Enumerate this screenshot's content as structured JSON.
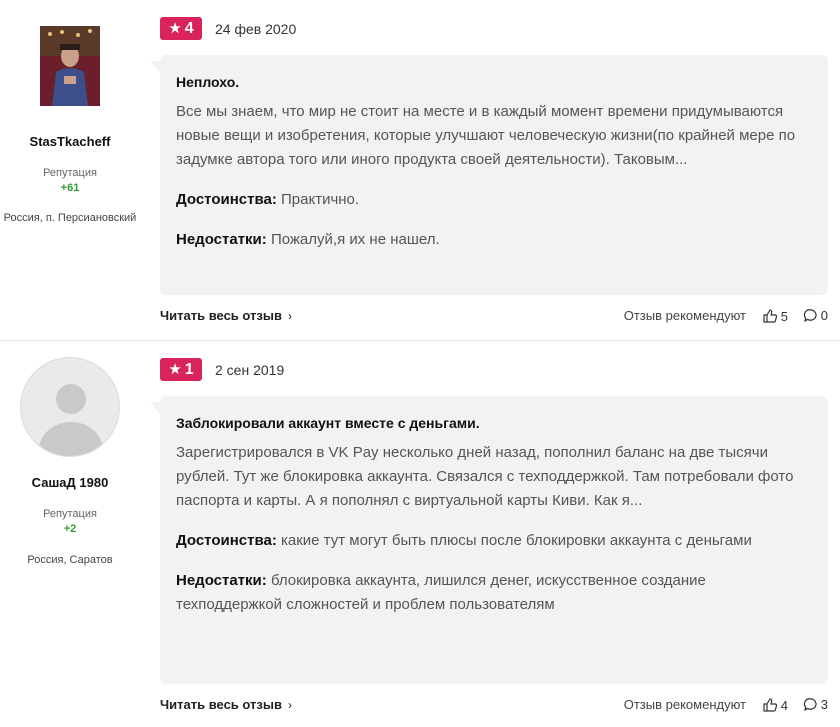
{
  "reviews": [
    {
      "author": {
        "name": "StasTkacheff",
        "reputation_label": "Репутация",
        "reputation_value": "+61",
        "location": "Россия, п. Персиановский"
      },
      "rating": "4",
      "date": "24 фев 2020",
      "title": "Неплохо.",
      "text": "Все мы знаем, что мир не стоит на месте и в каждый момент времени придумываются новые вещи и изобретения, которые улучшают человеческую жизни(по крайней мере по задумке автора того или иного продукта своей деятельности). Таковым...",
      "pros_label": "Достоинства:",
      "pros": "Практично.",
      "cons_label": "Недостатки:",
      "cons": "Пожалуй,я их не нашел.",
      "read_more": "Читать весь отзыв",
      "recommend_label": "Отзыв рекомендуют",
      "likes": "5",
      "comments": "0"
    },
    {
      "author": {
        "name": "СашаД 1980",
        "reputation_label": "Репутация",
        "reputation_value": "+2",
        "location": "Россия, Саратов"
      },
      "rating": "1",
      "date": "2 сен 2019",
      "title": "Заблокировали аккаунт вместе с деньгами.",
      "text": "Зарегистрировался в VK Pay несколько дней назад, пополнил баланс на две тысячи рублей. Тут же блокировка аккаунта. Связался с техподдержкой. Там потребовали фото паспорта и карты. А я пополнял с виртуальной карты Киви. Как я...",
      "pros_label": "Достоинства:",
      "pros": "какие тут могут быть плюсы после блокировки аккаунта с деньгами",
      "cons_label": "Недостатки:",
      "cons": "блокировка аккаунта, лишился денег, искусственное создание техподдержкой сложностей и проблем пользователям",
      "read_more": "Читать весь отзыв",
      "recommend_label": "Отзыв рекомендуют",
      "likes": "4",
      "comments": "3"
    }
  ],
  "icons": {
    "star": "star-icon",
    "thumb": "thumbs-up-icon",
    "comment": "comment-icon",
    "chevron": "chevron-right-icon"
  },
  "colors": {
    "rating_badge": "#d8235c",
    "reputation": "#2e9e2e",
    "body_bg": "#f2f2f2"
  }
}
